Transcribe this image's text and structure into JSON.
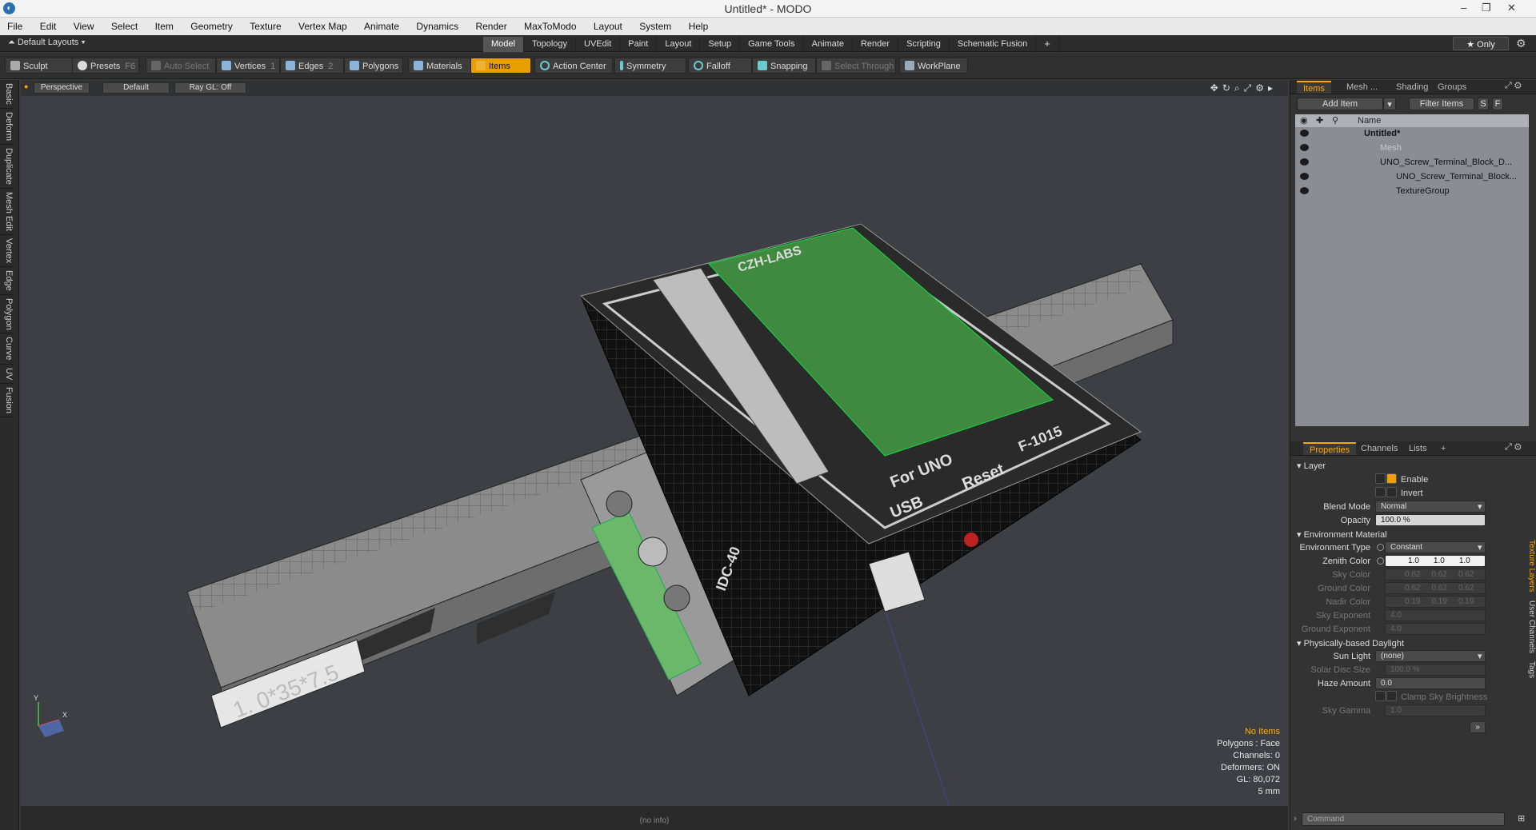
{
  "window": {
    "title": "Untitled* - MODO",
    "min": "–",
    "restore": "❐",
    "close": "✕"
  },
  "menu": [
    "File",
    "Edit",
    "View",
    "Select",
    "Item",
    "Geometry",
    "Texture",
    "Vertex Map",
    "Animate",
    "Dynamics",
    "Render",
    "MaxToModo",
    "Layout",
    "System",
    "Help"
  ],
  "layout_label": "Default Layouts ▾",
  "tabs": [
    "Model",
    "Topology",
    "UVEdit",
    "Paint",
    "Layout",
    "Setup",
    "Game Tools",
    "Animate",
    "Render",
    "Scripting",
    "Schematic Fusion",
    "+"
  ],
  "only_label": "★  Only",
  "toolbar": {
    "sculpt": "Sculpt",
    "presets": "Presets",
    "presets_key": "F6",
    "auto_select": "Auto Select",
    "vertices": "Vertices",
    "vertices_key": "1",
    "edges": "Edges",
    "edges_key": "2",
    "polygons": "Polygons",
    "materials": "Materials",
    "items": "Items",
    "action_center": "Action Center",
    "symmetry": "Symmetry",
    "falloff": "Falloff",
    "snapping": "Snapping",
    "select_through": "Select Through",
    "workplane": "WorkPlane"
  },
  "left_tabs": [
    "Basic",
    "Deform",
    "Duplicate",
    "Mesh Edit",
    "Vertex",
    "Edge",
    "Polygon",
    "Curve",
    "UV",
    "Fusion"
  ],
  "viewport": {
    "view": "Perspective",
    "shading": "Default",
    "raygl": "Ray GL: Off",
    "stats": {
      "warn": "No Items",
      "polygons": "Polygons : Face",
      "channels": "Channels: 0",
      "deformers": "Deformers: ON",
      "gl": "GL: 80,072",
      "units": "5 mm"
    },
    "axis_y": "Y",
    "axis_x": "X",
    "model_label_rail": "1. 0*35*7.5",
    "model_label_top": "CZH-LABS",
    "model_label_for": "For UNO",
    "model_label_f": "F-1015",
    "model_label_usb": "USB",
    "model_label_reset": "Reset",
    "model_label_side": "IDC-40",
    "status": "(no info)"
  },
  "items_panel": {
    "tabs": [
      "Items",
      "Mesh ...",
      "Shading",
      "Groups"
    ],
    "add_item": "Add Item",
    "filter": "Filter Items",
    "s": "S",
    "f": "F",
    "name_col": "Name",
    "rows": [
      {
        "label": "Untitled*",
        "indent": 0
      },
      {
        "label": "Mesh",
        "indent": 1
      },
      {
        "label": "UNO_Screw_Terminal_Block_D...",
        "indent": 1
      },
      {
        "label": "UNO_Screw_Terminal_Block...",
        "indent": 2
      },
      {
        "label": "TextureGroup",
        "indent": 1
      }
    ]
  },
  "props_panel": {
    "tabs": [
      "Properties",
      "Channels",
      "Lists",
      "+"
    ],
    "layer": "Layer",
    "enable": "Enable",
    "invert": "Invert",
    "blend_mode_label": "Blend Mode",
    "blend_mode": "Normal",
    "opacity_label": "Opacity",
    "opacity": "100.0 %",
    "env_material": "Environment Material",
    "env_type_label": "Environment Type",
    "env_type": "Constant",
    "zenith_label": "Zenith Color",
    "zenith": [
      "1.0",
      "1.0",
      "1.0"
    ],
    "sky_label": "Sky Color",
    "sky": [
      "0.62",
      "0.62",
      "0.62"
    ],
    "ground_label": "Ground Color",
    "ground": [
      "0.62",
      "0.62",
      "0.62"
    ],
    "nadir_label": "Nadir Color",
    "nadir": [
      "0.19",
      "0.19",
      "0.19"
    ],
    "sky_exp_label": "Sky Exponent",
    "sky_exp": "4.0",
    "ground_exp_label": "Ground Exponent",
    "ground_exp": "4.0",
    "daylight": "Physically-based Daylight",
    "sun_label": "Sun Light",
    "sun": "(none)",
    "disc_label": "Solar Disc Size",
    "disc": "100.0 %",
    "haze_label": "Haze Amount",
    "haze": "0.0",
    "clamp": "Clamp Sky Brightness",
    "gamma_label": "Sky Gamma",
    "gamma": "1.0",
    "vtabs": [
      "Texture Layers",
      "User Channels",
      "Tags"
    ],
    "command": "Command"
  }
}
